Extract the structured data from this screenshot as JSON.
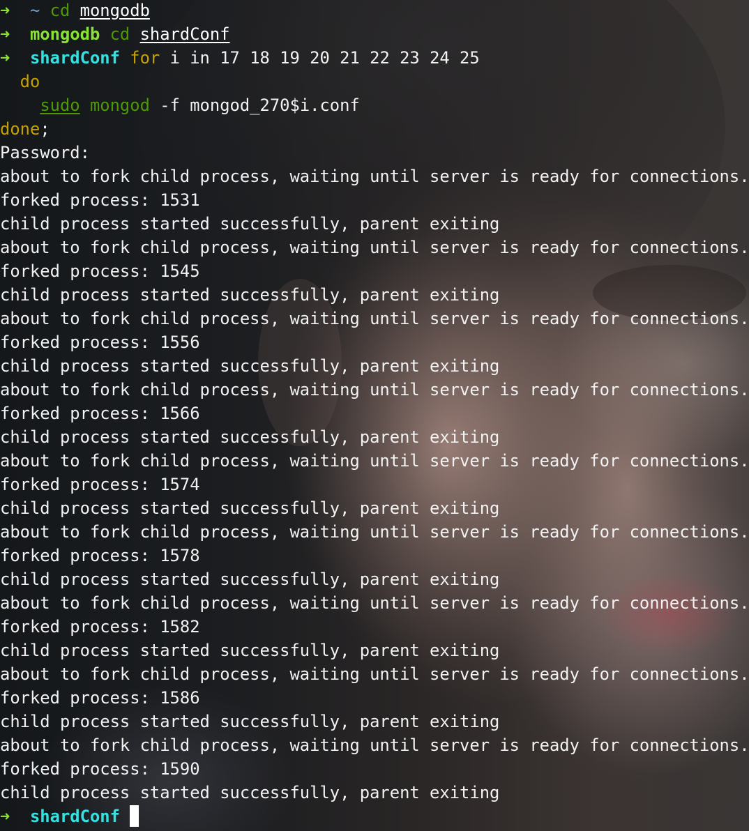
{
  "colors": {
    "prompt_arrow": "#8ae234",
    "directory": "#34e2e2",
    "keyword": "#c4a000",
    "text": "#f2f2f2",
    "command_dim": "#4e9a06"
  },
  "icons": {
    "prompt_arrow": "right-arrow-icon",
    "cursor": "block-cursor"
  },
  "prompt": {
    "arrow": "➜",
    "home": "~",
    "dir_mongodb": "mongodb",
    "dir_shardconf": "shardConf"
  },
  "commands": {
    "cmd1": {
      "verb": "cd",
      "arg": "mongodb"
    },
    "cmd2": {
      "verb": "cd",
      "arg": "shardConf"
    },
    "cmd3": {
      "kw_for": "for",
      "rest": "i in 17 18 19 20 21 22 23 24 25",
      "kw_do": "do",
      "sudo": "sudo",
      "prog": "mongod",
      "args": "-f mongod_270$i.conf",
      "kw_done": "done",
      "semicolon": ";"
    }
  },
  "output": {
    "password_prompt": "Password:",
    "blocks": [
      {
        "about": "about to fork child process, waiting until server is ready for connections.",
        "forked": "forked process: 1531",
        "started": "child process started successfully, parent exiting"
      },
      {
        "about": "about to fork child process, waiting until server is ready for connections.",
        "forked": "forked process: 1545",
        "started": "child process started successfully, parent exiting"
      },
      {
        "about": "about to fork child process, waiting until server is ready for connections.",
        "forked": "forked process: 1556",
        "started": "child process started successfully, parent exiting"
      },
      {
        "about": "about to fork child process, waiting until server is ready for connections.",
        "forked": "forked process: 1566",
        "started": "child process started successfully, parent exiting"
      },
      {
        "about": "about to fork child process, waiting until server is ready for connections.",
        "forked": "forked process: 1574",
        "started": "child process started successfully, parent exiting"
      },
      {
        "about": "about to fork child process, waiting until server is ready for connections.",
        "forked": "forked process: 1578",
        "started": "child process started successfully, parent exiting"
      },
      {
        "about": "about to fork child process, waiting until server is ready for connections.",
        "forked": "forked process: 1582",
        "started": "child process started successfully, parent exiting"
      },
      {
        "about": "about to fork child process, waiting until server is ready for connections.",
        "forked": "forked process: 1586",
        "started": "child process started successfully, parent exiting"
      },
      {
        "about": "about to fork child process, waiting until server is ready for connections.",
        "forked": "forked process: 1590",
        "started": "child process started successfully, parent exiting"
      }
    ]
  }
}
